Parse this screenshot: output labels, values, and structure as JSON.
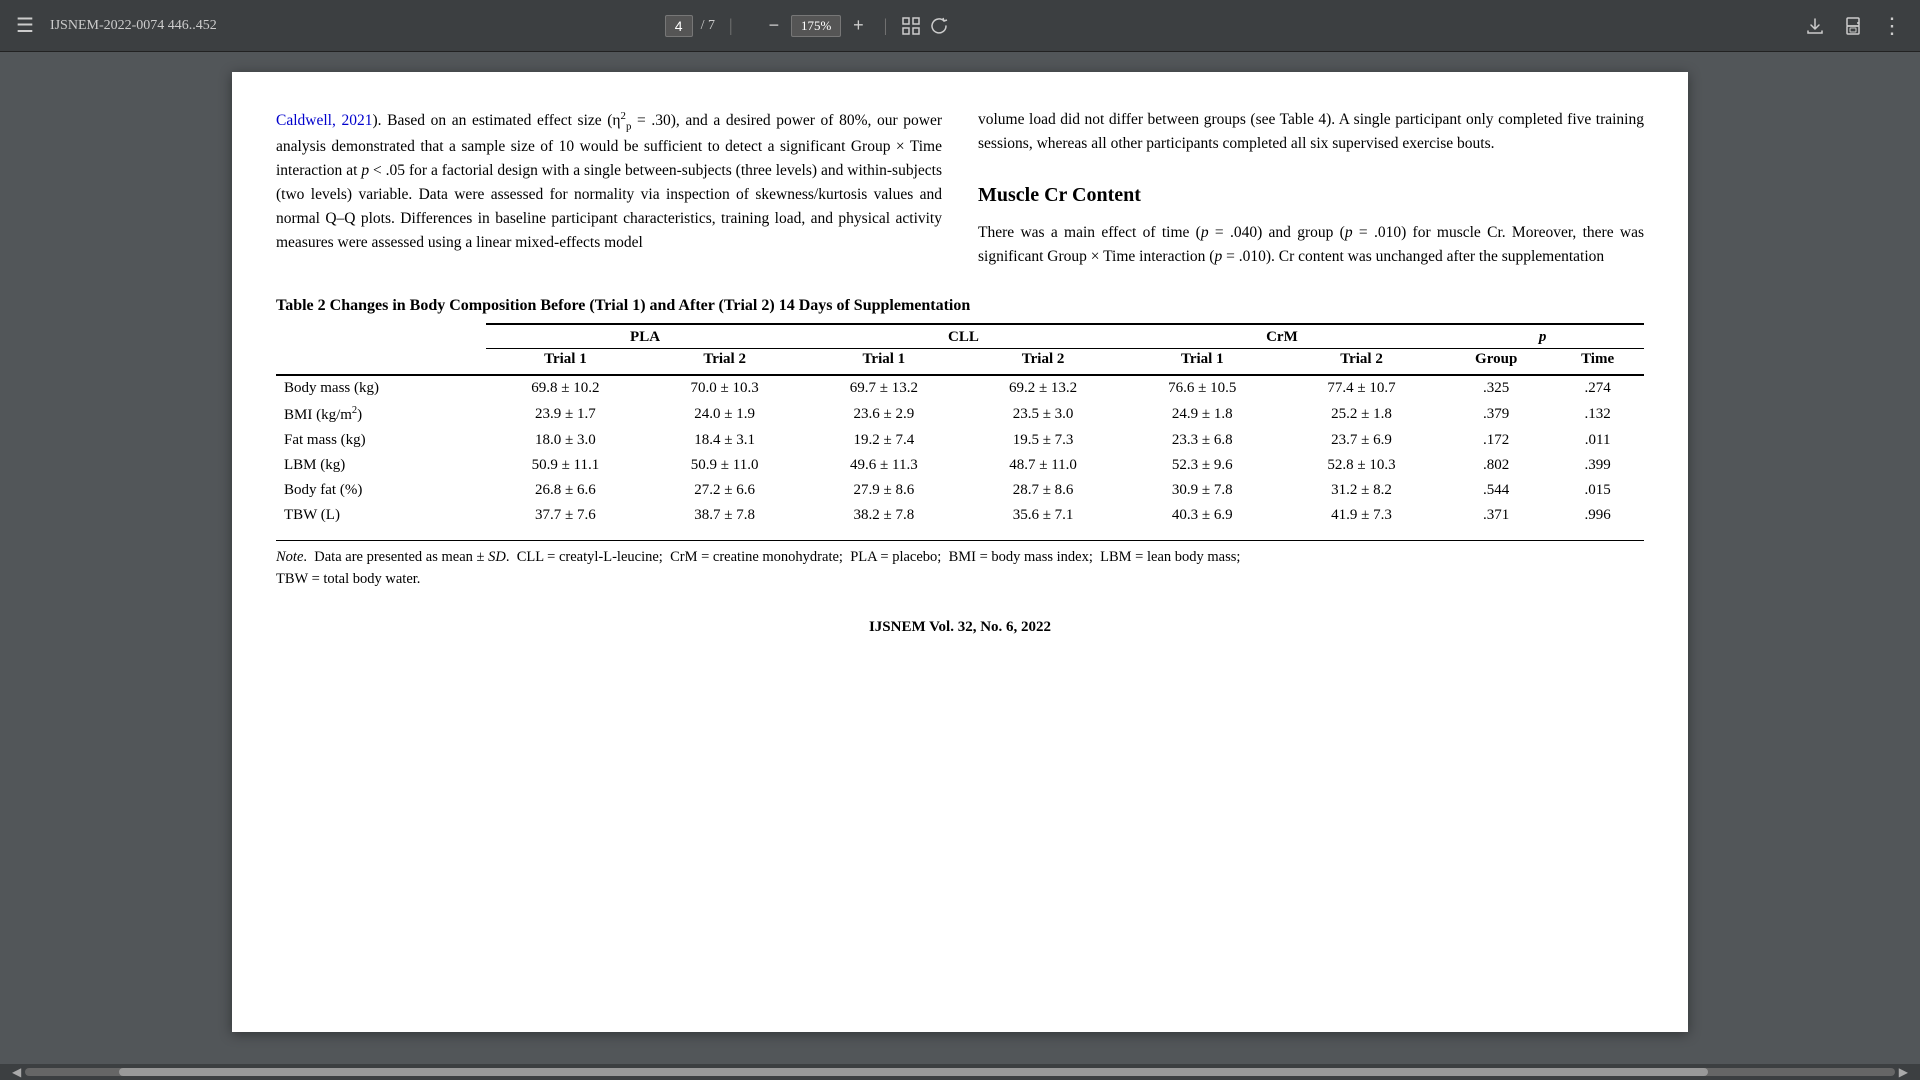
{
  "toolbar": {
    "menu_label": "☰",
    "filename": "IJSNEM-2022-0074 446..452",
    "current_page": "4",
    "total_pages": "7",
    "zoom": "175%",
    "download_label": "⬇",
    "print_label": "🖶",
    "more_label": "⋮",
    "fit_label": "⛶",
    "rotate_label": "↺"
  },
  "left_col": {
    "text_parts": [
      {
        "type": "link",
        "text": "Caldwell, 2021"
      },
      {
        "type": "text",
        "text": "). Based on an estimated effect size (η"
      },
      {
        "type": "sup",
        "text": "2"
      },
      {
        "type": "sub",
        "text": "p"
      },
      {
        "type": "text",
        "text": " = .30), and a desired power of 80%, our power analysis demonstrated that a sample size of 10 would be sufficient to detect a significant Group × Time interaction at "
      },
      {
        "type": "italic",
        "text": "p"
      },
      {
        "type": "text",
        "text": " < .05 for a factorial design with a single between-subjects (three levels) and within-subjects (two levels) variable. Data were assessed for normality via inspection of skewness/kurtosis values and normal Q–Q plots. Differences in baseline participant characteristics, training load, and physical activity measures were assessed using a linear mixed-effects model"
      }
    ]
  },
  "right_col": {
    "lines": [
      "volume load did not differ between groups (see Table 4). A single participant only completed five training sessions, whereas all other participants completed all six supervised exercise bouts."
    ],
    "section_heading": "Muscle Cr Content",
    "section_text": "There was a main effect of time (p = .040) and group (p = .010) for muscle Cr. Moreover, there was significant Group × Time interaction (p = .010). Cr content was unchanged after the supplementation"
  },
  "table": {
    "title": "Table 2    Changes in Body Composition Before (Trial 1) and After (Trial 2) 14 Days of Supplementation",
    "groups": [
      "PLA",
      "CLL",
      "CrM",
      "p"
    ],
    "subgroups": [
      "Trial 1",
      "Trial 2",
      "Trial 1",
      "Trial 2",
      "Trial 1",
      "Trial 2",
      "Group",
      "Time"
    ],
    "rows": [
      {
        "label": "Body mass (kg)",
        "values": [
          "69.8 ± 10.2",
          "70.0 ± 10.3",
          "69.7 ± 13.2",
          "69.2 ± 13.2",
          "76.6 ± 10.5",
          "77.4 ± 10.7",
          ".325",
          ".274"
        ]
      },
      {
        "label": "BMI (kg/m²)",
        "values": [
          "23.9 ± 1.7",
          "24.0 ± 1.9",
          "23.6 ± 2.9",
          "23.5 ± 3.0",
          "24.9 ± 1.8",
          "25.2 ± 1.8",
          ".379",
          ".132"
        ]
      },
      {
        "label": "Fat mass (kg)",
        "values": [
          "18.0 ± 3.0",
          "18.4 ± 3.1",
          "19.2 ± 7.4",
          "19.5 ± 7.3",
          "23.3 ± 6.8",
          "23.7 ± 6.9",
          ".172",
          ".011"
        ]
      },
      {
        "label": "LBM (kg)",
        "values": [
          "50.9 ± 11.1",
          "50.9 ± 11.0",
          "49.6 ± 11.3",
          "48.7 ± 11.0",
          "52.3 ± 9.6",
          "52.8 ± 10.3",
          ".802",
          ".399"
        ]
      },
      {
        "label": "Body fat (%)",
        "values": [
          "26.8 ± 6.6",
          "27.2 ± 6.6",
          "27.9 ± 8.6",
          "28.7 ± 8.6",
          "30.9 ± 7.8",
          "31.2 ± 8.2",
          ".544",
          ".015"
        ]
      },
      {
        "label": "TBW (L)",
        "values": [
          "37.7 ± 7.6",
          "38.7 ± 7.8",
          "38.2 ± 7.8",
          "35.6 ± 7.1",
          "40.3 ± 6.9",
          "41.9 ± 7.3",
          ".371",
          ".996"
        ]
      }
    ],
    "note": "Note.  Data are presented as mean ± SD.  CLL = creatyl-L-leucine;  CrM = creatine monohydrate;  PLA = placebo;  BMI = body mass index;  LBM = lean body mass; TBW = total body water."
  },
  "footer": {
    "journal": "IJSNEM Vol. 32, No. 6, 2022"
  }
}
